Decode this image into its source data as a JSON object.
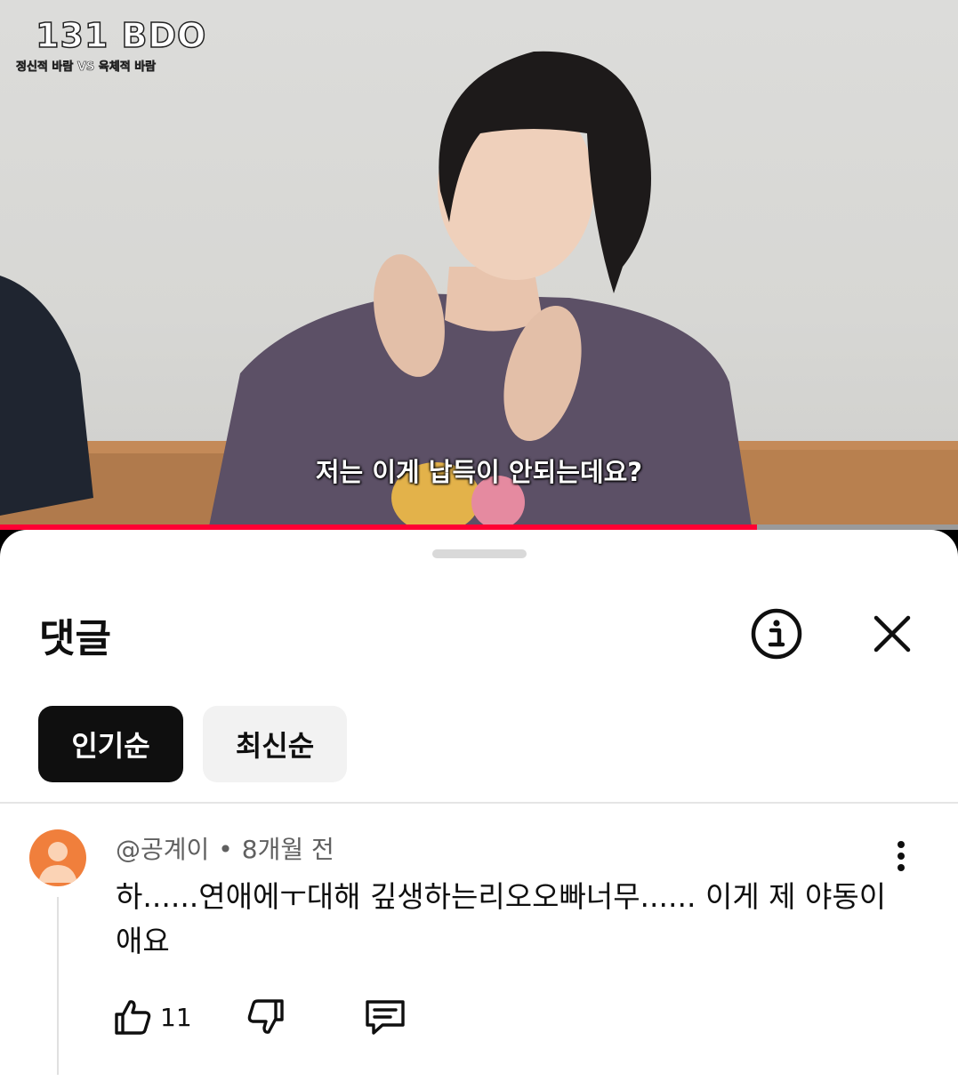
{
  "video": {
    "watermark_logo": "131 BDO",
    "watermark_subtitle": "정신적 바람 VS 육체적 바람",
    "caption": "저는 이게 납득이 안되는데요?",
    "progress_fraction": 0.79
  },
  "comments_panel": {
    "title": "댓글",
    "icons": {
      "info": "info-icon",
      "close": "close-icon"
    },
    "sort_chips": [
      {
        "label": "인기순",
        "selected": true
      },
      {
        "label": "최신순",
        "selected": false
      }
    ],
    "comment": {
      "author": "@공계이",
      "separator": "•",
      "time": "8개월 전",
      "text": "하......연애에ㅜ대해 깊생하는리오오빠너무...... 이게 제 야동이애요",
      "like_count": "11",
      "icons": [
        "like-icon",
        "dislike-icon",
        "reply-icon",
        "more-vertical-icon",
        "avatar"
      ]
    }
  },
  "colors": {
    "accent_progress": "#ff0033",
    "chip_active_bg": "#0f0f0f",
    "avatar_bg": "#f07f3c"
  }
}
